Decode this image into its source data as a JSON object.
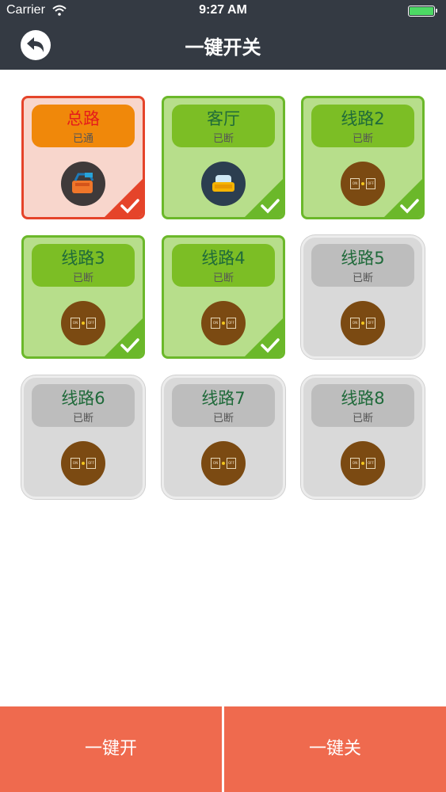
{
  "status": {
    "carrier": "Carrier",
    "time": "9:27 AM"
  },
  "nav": {
    "title": "一键开关",
    "back_icon": "back-arrow-icon"
  },
  "tiles": [
    {
      "name": "总路",
      "state": "已通",
      "style": "red",
      "icon": "switchboard-icon",
      "checked": true
    },
    {
      "name": "客厅",
      "state": "已断",
      "style": "green",
      "icon": "sofa-icon",
      "checked": true
    },
    {
      "name": "线路2",
      "state": "已断",
      "style": "green",
      "icon": "power-switch-icon",
      "checked": true
    },
    {
      "name": "线路3",
      "state": "已断",
      "style": "green",
      "icon": "power-switch-icon",
      "checked": true
    },
    {
      "name": "线路4",
      "state": "已断",
      "style": "green",
      "icon": "power-switch-icon",
      "checked": true
    },
    {
      "name": "线路5",
      "state": "已断",
      "style": "gray",
      "icon": "power-switch-icon",
      "checked": false
    },
    {
      "name": "线路6",
      "state": "已断",
      "style": "gray",
      "icon": "power-switch-icon",
      "checked": false
    },
    {
      "name": "线路7",
      "state": "已断",
      "style": "gray",
      "icon": "power-switch-icon",
      "checked": false
    },
    {
      "name": "线路8",
      "state": "已断",
      "style": "gray",
      "icon": "power-switch-icon",
      "checked": false
    }
  ],
  "switch_icon": {
    "on_label": "ON",
    "off_label": "OFF"
  },
  "buttons": {
    "all_on": "一键开",
    "all_off": "一键关"
  },
  "colors": {
    "topbar": "#343a43",
    "active_red": "#e5442a",
    "active_green": "#6bb82a",
    "inactive_gray": "#d9d9d9",
    "bottom_button": "#ef6a4e"
  }
}
